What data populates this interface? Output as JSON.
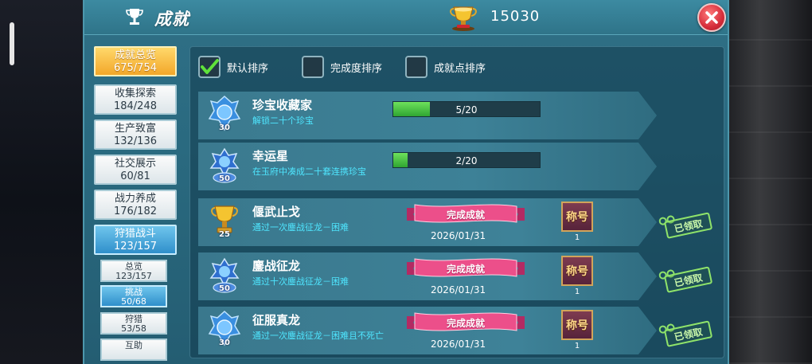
{
  "header": {
    "title": "成就",
    "score": "15030"
  },
  "categories": [
    {
      "name": "成就总览",
      "progress": "675/754"
    },
    {
      "name": "收集探索",
      "progress": "184/248"
    },
    {
      "name": "生产致富",
      "progress": "132/136"
    },
    {
      "name": "社交展示",
      "progress": "60/81"
    },
    {
      "name": "战力养成",
      "progress": "176/182"
    },
    {
      "name": "狩猎战斗",
      "progress": "123/157"
    }
  ],
  "subcategories": [
    {
      "name": "总览",
      "progress": "123/157"
    },
    {
      "name": "挑战",
      "progress": "50/68"
    },
    {
      "name": "狩猎",
      "progress": "53/58"
    },
    {
      "name": "互助",
      "progress": ""
    }
  ],
  "sort": {
    "default": "默认排序",
    "completion": "完成度排序",
    "points": "成就点排序",
    "selected": "default"
  },
  "achievements": [
    {
      "title": "珍宝收藏家",
      "desc": "解锁二十个珍宝",
      "points": "30",
      "medal": "blue-crystal-medal",
      "progress": "5/20",
      "progress_fraction": 0.25
    },
    {
      "title": "幸运星",
      "desc": "在玉府中凑成二十套连携珍宝",
      "points": "50",
      "medal": "blue-wing-medal",
      "progress": "2/20",
      "progress_fraction": 0.1
    },
    {
      "title": "偃武止戈",
      "desc": "通过一次鏖战征龙－困难",
      "points": "25",
      "medal": "gold-trophy",
      "status": "完成成就",
      "date": "2026/01/31",
      "reward_label": "称号",
      "reward_count": "1",
      "claimed": "已领取"
    },
    {
      "title": "鏖战征龙",
      "desc": "通过十次鏖战征龙－困难",
      "points": "50",
      "medal": "blue-wing-medal",
      "status": "完成成就",
      "date": "2026/01/31",
      "reward_label": "称号",
      "reward_count": "1",
      "claimed": "已领取"
    },
    {
      "title": "征服真龙",
      "desc": "通过一次鏖战征龙－困难且不死亡",
      "points": "30",
      "medal": "blue-crystal-medal",
      "status": "完成成就",
      "date": "2026/01/31",
      "reward_label": "称号",
      "reward_count": "1",
      "claimed": "已领取"
    }
  ],
  "colors": {
    "accent_gold": "#f2a72a",
    "desc_cyan": "#4fe6ff",
    "progress_green": "#2fa531",
    "ribbon_pink": "#e8457f",
    "close_red": "#d52d3a"
  }
}
